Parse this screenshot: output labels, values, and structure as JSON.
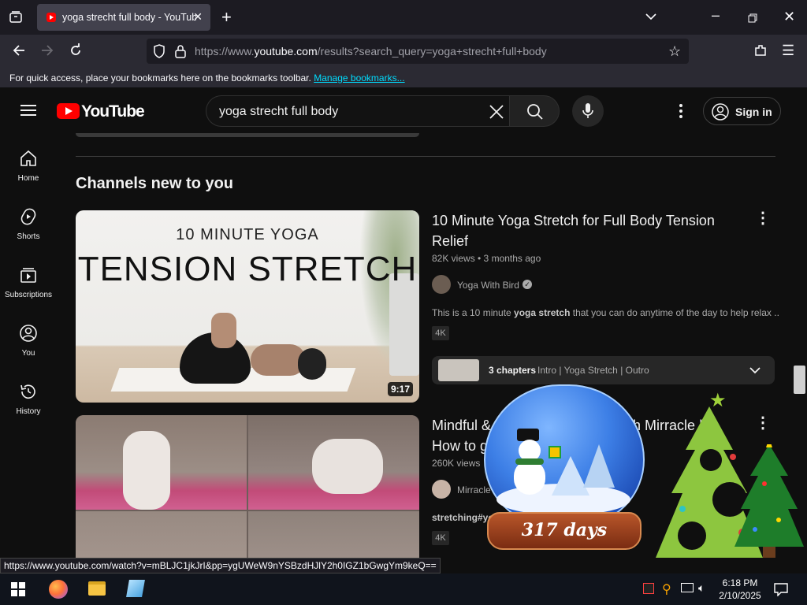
{
  "browser": {
    "tab_title": "yoga strecht full body - YouTube",
    "url_prefix": "https://www.",
    "url_domain": "youtube.com",
    "url_path": "/results?search_query=yoga+strecht+full+body",
    "bookmarks_text": "For quick access, place your bookmarks here on the bookmarks toolbar.",
    "bookmarks_link": "Manage bookmarks...",
    "status_url": "https://www.youtube.com/watch?v=mBLJC1jkJrI&pp=ygUWeW9nYSBzdHJlY2h0IGZ1bGwgYm9keQ=="
  },
  "youtube": {
    "logo_text": "YouTube",
    "search_query": "yoga strecht full body",
    "sign_in": "Sign in",
    "sidebar": [
      {
        "label": "Home",
        "icon": "home-icon"
      },
      {
        "label": "Shorts",
        "icon": "shorts-icon"
      },
      {
        "label": "Subscriptions",
        "icon": "subscriptions-icon"
      },
      {
        "label": "You",
        "icon": "you-icon"
      },
      {
        "label": "History",
        "icon": "history-icon"
      }
    ],
    "section_title": "Channels new to you",
    "videos": [
      {
        "title": "10 Minute Yoga Stretch for Full Body Tension Relief",
        "meta": "82K views • 3 months ago",
        "channel": "Yoga With Bird",
        "verified": true,
        "desc_pre": "This is a 10 minute ",
        "desc_bold": "yoga stretch",
        "desc_post": " that you can do anytime of the day to help relax ...",
        "badge": "4K",
        "duration": "9:17",
        "thumb_line1": "10 MINUTE YOGA",
        "thumb_line2": "TENSION STRETCH",
        "chapters_count": "3 chapters",
        "chapters_list": "Intro | Yoga Stretch | Outro"
      },
      {
        "title_start": "Mindful &",
        "title_end": "th Mirracle |",
        "title_line2": "How to g",
        "meta": "260K views",
        "channel": "Mirracle",
        "desc": "stretching#yog",
        "badge": "4K"
      }
    ]
  },
  "widget": {
    "days_text": "317 days"
  },
  "taskbar": {
    "time": "6:18 PM",
    "date": "2/10/2025"
  },
  "colors": {
    "yt_red": "#ff0000",
    "link_blue": "#00ddff",
    "tree_green": "#8dc63f"
  }
}
